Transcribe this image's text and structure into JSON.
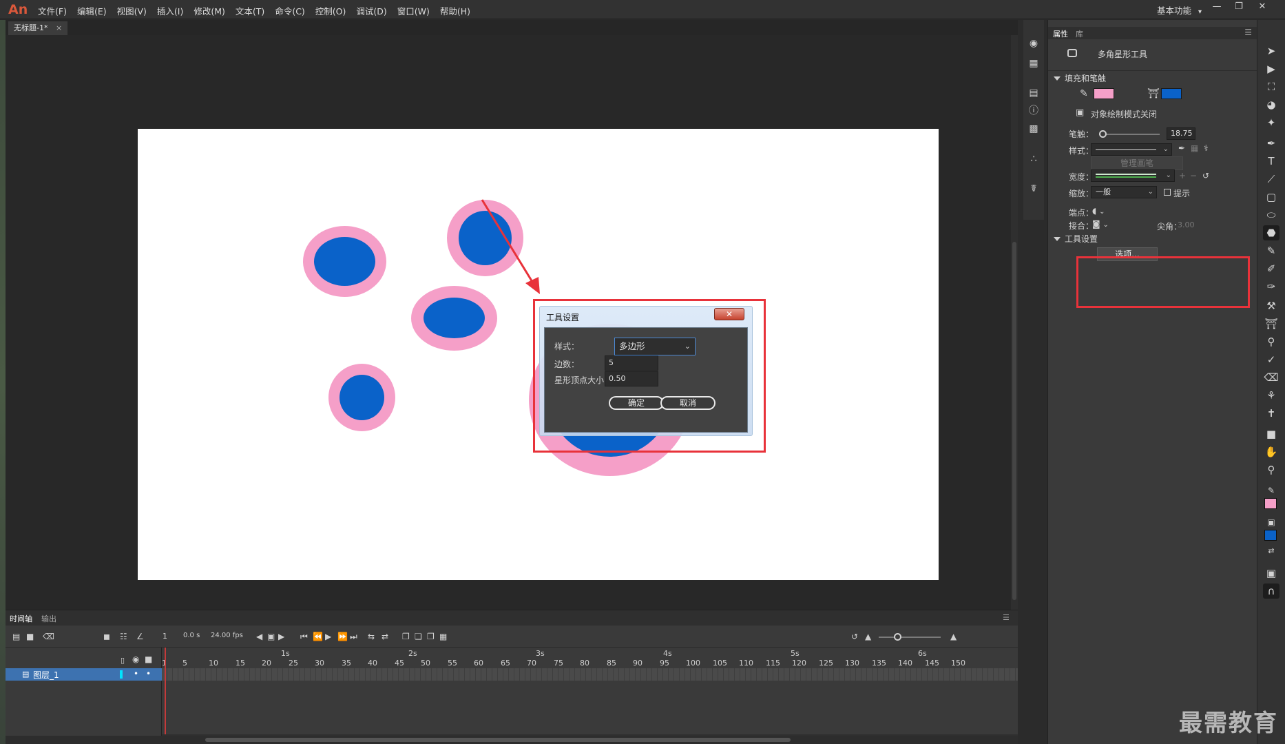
{
  "app": {
    "logo": "An",
    "menu": [
      "文件(F)",
      "编辑(E)",
      "视图(V)",
      "插入(I)",
      "修改(M)",
      "文本(T)",
      "命令(C)",
      "控制(O)",
      "调试(D)",
      "窗口(W)",
      "帮助(H)"
    ],
    "workspace": "基本功能",
    "workspace_chevron": "▾"
  },
  "document": {
    "tab_title": "无标题-1*",
    "tab_close": "×"
  },
  "dialog": {
    "title": "工具设置",
    "close": "✕",
    "style_label": "样式：",
    "style_value": "多边形",
    "sides_label": "边数：",
    "sides_value": "5",
    "star_label": "星形顶点大小：",
    "star_value": "0.50",
    "ok": "确定",
    "cancel": "取消"
  },
  "properties": {
    "tabs": [
      "属性",
      "库"
    ],
    "tool_name": "多角星形工具",
    "fill_stroke": "填充和笔触",
    "stroke_color": "#f59fc8",
    "fill_color": "#0a62c9",
    "object_draw": "对象绘制模式关闭",
    "stroke_label": "笔触：",
    "stroke_value": "18.75",
    "style_label": "样式：",
    "manage_brush": "管理画笔",
    "width_label": "宽度：",
    "scale_label": "缩放：",
    "scale_value": "一般",
    "hint_label": "提示",
    "cap_label": "端点：",
    "join_label": "接合：",
    "miter_label": "尖角：",
    "miter_value": "3.00",
    "tool_settings": "工具设置",
    "options_button": "选项..."
  },
  "timeline": {
    "tabs": [
      "时间轴",
      "输出"
    ],
    "frame": "1",
    "time": "0.0 s",
    "fps": "24.00 fps",
    "layer_name": "图层_1",
    "seconds": [
      "1s",
      "2s",
      "3s",
      "4s",
      "5s",
      "6s"
    ],
    "frames": [
      "1",
      "5",
      "10",
      "15",
      "20",
      "25",
      "30",
      "35",
      "40",
      "45",
      "50",
      "55",
      "60",
      "65",
      "70",
      "75",
      "80",
      "85",
      "90",
      "95",
      "100",
      "105",
      "110",
      "115",
      "120",
      "125",
      "130",
      "135",
      "140",
      "145",
      "150"
    ]
  },
  "watermark": "最需教育"
}
